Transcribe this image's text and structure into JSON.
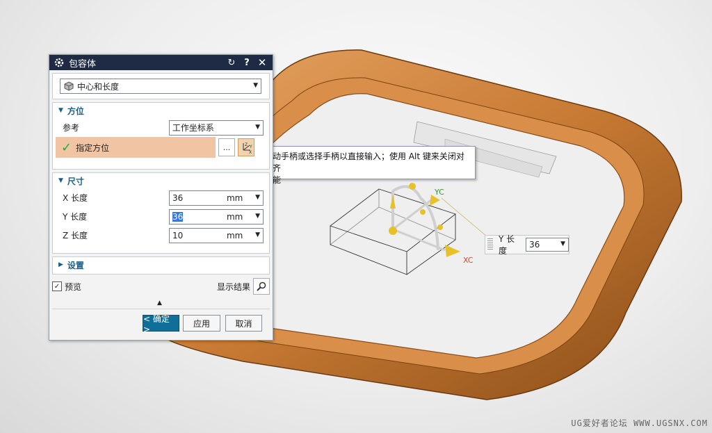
{
  "dialog": {
    "title": "包容体",
    "type_select": "中心和长度",
    "orientation": {
      "header": "方位",
      "reference_label": "参考",
      "reference_value": "工作坐标系",
      "specify_label": "指定方位",
      "dots": "...",
      "csys_glyph": "ZYX"
    },
    "dimensions": {
      "header": "尺寸",
      "x_label": "X 长度",
      "x_value": "36",
      "x_unit": "mm",
      "y_label": "Y 长度",
      "y_value": "36",
      "y_unit": "mm",
      "z_label": "Z 长度",
      "z_value": "10",
      "z_unit": "mm"
    },
    "settings": {
      "header": "设置"
    },
    "preview_label": "预览",
    "preview_checked": "✓",
    "show_result_label": "显示结果",
    "ok_label": "< 确定 >",
    "apply_label": "应用",
    "cancel_label": "取消"
  },
  "tooltip": {
    "line1": "动手柄或选择手柄以直接输入；使用 Alt 键来关闭对齐",
    "line2": "能"
  },
  "onscreen_input": {
    "label": "Y 长度",
    "value": "36"
  },
  "axis_labels": {
    "yc": "YC",
    "xc": "XC"
  },
  "watermark": "UG爱好者论坛 WWW.UGSNX.COM",
  "colors": {
    "title_bar": "#1f2a44",
    "accent": "#1a5f88",
    "model": "#c77a33",
    "highlight_row": "#f1c4a4"
  }
}
